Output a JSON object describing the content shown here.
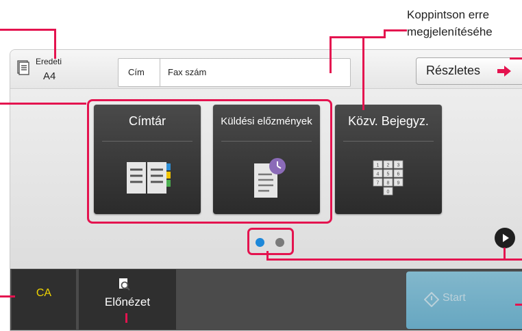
{
  "callout": {
    "line1": "Koppintson erre",
    "line2": "megjelenítéséhe"
  },
  "header": {
    "original_label": "Eredeti",
    "original_size": "A4",
    "address_left": "Cím",
    "address_right": "Fax szám",
    "details_label": "Részletes"
  },
  "tiles": [
    {
      "label": "Címtár",
      "icon": "address-book-icon"
    },
    {
      "label": "Küldési előzmények",
      "icon": "send-history-icon"
    },
    {
      "label": "Közv. Bejegyz.",
      "icon": "keypad-icon"
    }
  ],
  "keypad_keys": [
    "1",
    "2",
    "3",
    "4",
    "5",
    "6",
    "7",
    "8",
    "9",
    "0"
  ],
  "pager": {
    "page_count": 2,
    "current_page": 1
  },
  "footer": {
    "ca_label": "CA",
    "preview_label": "Előnézet",
    "start_label": "Start"
  },
  "colors": {
    "highlight": "#e4134f",
    "ca_text": "#f2d600",
    "start_button": "#7cc1de",
    "tile": "#3a3a3a",
    "dot_active": "#1d88d9",
    "dot_inactive": "#7a7a7a"
  }
}
